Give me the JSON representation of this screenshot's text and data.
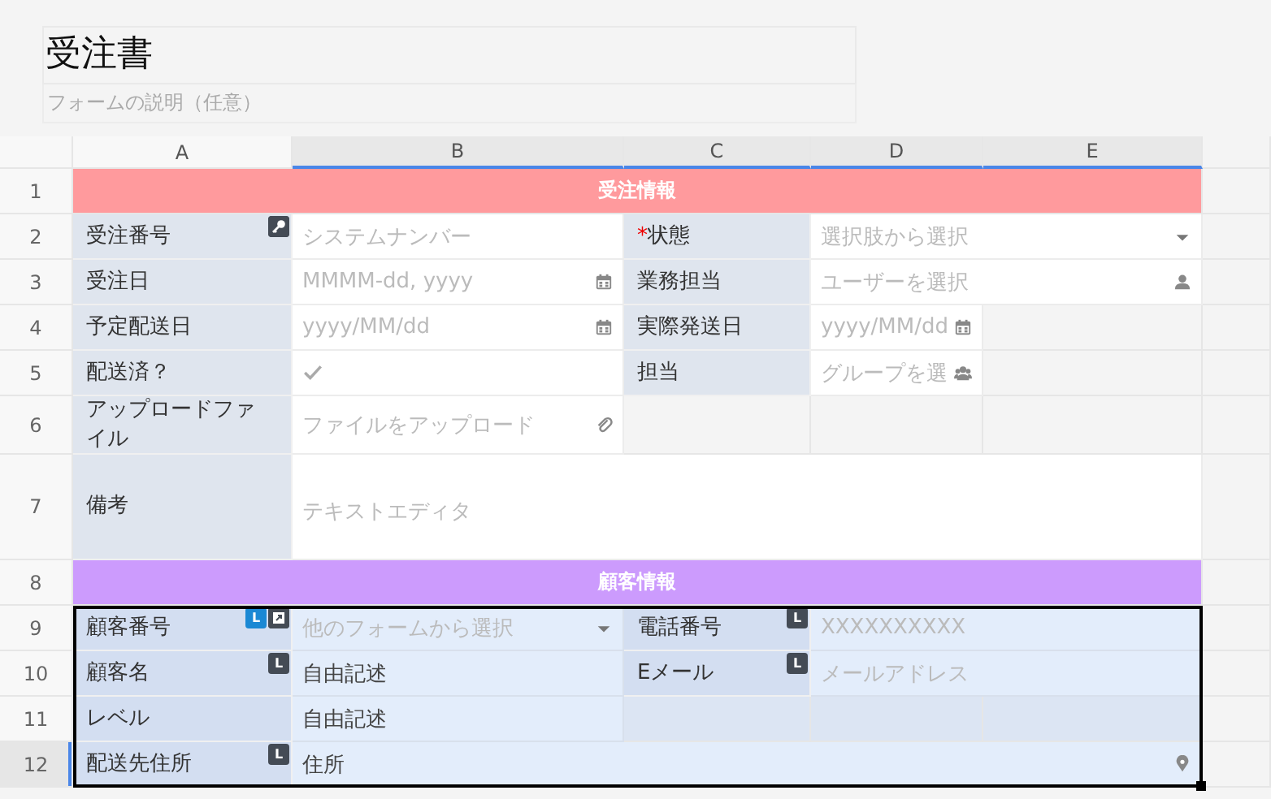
{
  "form": {
    "title": "受注書",
    "description_placeholder": "フォームの説明（任意）"
  },
  "columns": [
    {
      "label": "A",
      "selected": false
    },
    {
      "label": "B",
      "selected": true
    },
    {
      "label": "C",
      "selected": true
    },
    {
      "label": "D",
      "selected": true
    },
    {
      "label": "E",
      "selected": true
    }
  ],
  "rows": [
    {
      "number": "1",
      "selected": false,
      "in_selection": false,
      "cells": [
        {
          "kind": "band",
          "text": "受注情報",
          "color": "#ff9a9d"
        },
        {
          "kind": "merged"
        },
        {
          "kind": "merged"
        },
        {
          "kind": "merged"
        },
        {
          "kind": "merged"
        }
      ]
    },
    {
      "number": "2",
      "selected": false,
      "in_selection": false,
      "cells": [
        {
          "kind": "label",
          "text": "受注番号",
          "badges": [
            {
              "kind": "key"
            }
          ]
        },
        {
          "kind": "text",
          "placeholder": "システムナンバー"
        },
        {
          "kind": "label",
          "text": "状態",
          "required_mark": "*"
        },
        {
          "kind": "select",
          "placeholder": "選択肢から選択"
        },
        {
          "kind": "merged"
        }
      ]
    },
    {
      "number": "3",
      "selected": false,
      "in_selection": false,
      "cells": [
        {
          "kind": "label",
          "text": "受注日"
        },
        {
          "kind": "date",
          "placeholder": "MMMM-dd, yyyy"
        },
        {
          "kind": "label",
          "text": "業務担当"
        },
        {
          "kind": "user",
          "placeholder": "ユーザーを選択"
        },
        {
          "kind": "merged"
        }
      ]
    },
    {
      "number": "4",
      "selected": false,
      "in_selection": false,
      "cells": [
        {
          "kind": "label",
          "text": "予定配送日"
        },
        {
          "kind": "date",
          "placeholder": "yyyy/MM/dd"
        },
        {
          "kind": "label",
          "text": "実際発送日"
        },
        {
          "kind": "date",
          "placeholder": "yyyy/MM/dd"
        },
        {
          "kind": "empty"
        }
      ]
    },
    {
      "number": "5",
      "selected": false,
      "in_selection": false,
      "cells": [
        {
          "kind": "label",
          "text": "配送済？"
        },
        {
          "kind": "check",
          "checked": false
        },
        {
          "kind": "label",
          "text": "担当"
        },
        {
          "kind": "group",
          "placeholder": "グループを選"
        },
        {
          "kind": "empty"
        }
      ]
    },
    {
      "number": "6",
      "selected": false,
      "in_selection": false,
      "cells": [
        {
          "kind": "label",
          "text": "アップロードファイル"
        },
        {
          "kind": "file",
          "placeholder": "ファイルをアップロード"
        },
        {
          "kind": "empty"
        },
        {
          "kind": "empty"
        },
        {
          "kind": "empty"
        }
      ]
    },
    {
      "number": "7",
      "selected": false,
      "in_selection": false,
      "cells": [
        {
          "kind": "label",
          "text": "備考"
        },
        {
          "kind": "editor",
          "placeholder": "テキストエディタ"
        },
        {
          "kind": "merged"
        },
        {
          "kind": "merged"
        },
        {
          "kind": "merged"
        }
      ]
    },
    {
      "number": "8",
      "selected": false,
      "in_selection": false,
      "cells": [
        {
          "kind": "band",
          "text": "顧客情報",
          "color": "#cc9bfd"
        },
        {
          "kind": "merged"
        },
        {
          "kind": "merged"
        },
        {
          "kind": "merged"
        },
        {
          "kind": "merged"
        }
      ]
    },
    {
      "number": "9",
      "selected": false,
      "in_selection": true,
      "cells": [
        {
          "kind": "label",
          "text": "顧客番号",
          "badges": [
            {
              "kind": "tag",
              "text": "L",
              "color": "#1a88d4"
            },
            {
              "kind": "link"
            }
          ]
        },
        {
          "kind": "select",
          "placeholder": "他のフォームから選択"
        },
        {
          "kind": "label",
          "text": "電話番号",
          "badges": [
            {
              "kind": "tag",
              "text": "L",
              "color": "#444b55"
            }
          ]
        },
        {
          "kind": "text",
          "placeholder": "XXXXXXXXXX"
        },
        {
          "kind": "merged"
        }
      ]
    },
    {
      "number": "10",
      "selected": false,
      "in_selection": true,
      "cells": [
        {
          "kind": "label",
          "text": "顧客名",
          "badges": [
            {
              "kind": "tag",
              "text": "L",
              "color": "#444b55"
            }
          ]
        },
        {
          "kind": "text",
          "value": "自由記述"
        },
        {
          "kind": "label",
          "text": "Eメール",
          "badges": [
            {
              "kind": "tag",
              "text": "L",
              "color": "#444b55"
            }
          ]
        },
        {
          "kind": "text",
          "placeholder": "メールアドレス"
        },
        {
          "kind": "merged"
        }
      ]
    },
    {
      "number": "11",
      "selected": false,
      "in_selection": true,
      "cells": [
        {
          "kind": "label",
          "text": "レベル"
        },
        {
          "kind": "text",
          "value": "自由記述"
        },
        {
          "kind": "empty"
        },
        {
          "kind": "empty"
        },
        {
          "kind": "empty"
        }
      ]
    },
    {
      "number": "12",
      "selected": true,
      "in_selection": true,
      "cells": [
        {
          "kind": "label",
          "text": "配送先住所",
          "badges": [
            {
              "kind": "tag",
              "text": "L",
              "color": "#444b55"
            }
          ]
        },
        {
          "kind": "location",
          "value": "住所"
        },
        {
          "kind": "merged"
        },
        {
          "kind": "merged"
        },
        {
          "kind": "merged"
        }
      ]
    }
  ]
}
